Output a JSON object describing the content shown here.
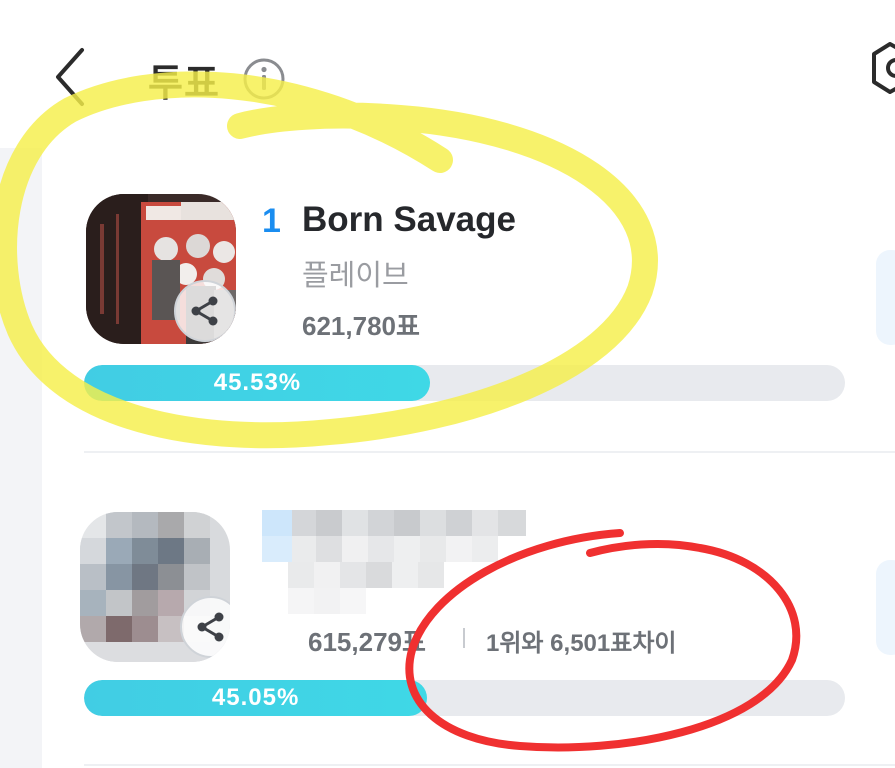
{
  "header": {
    "title": "투표",
    "back_icon": "chevron-left-icon",
    "info_icon": "info-circle-icon",
    "corner_icon": "hexagon-icon"
  },
  "entries": [
    {
      "rank": "1",
      "title": "Born Savage",
      "artist": "플레이브",
      "votes": "621,780표",
      "percent_label": "45.53%",
      "percent": 45.53
    },
    {
      "rank": "",
      "title": "",
      "artist": "",
      "votes": "615,279표",
      "gap_label": "1위와 6,501표차이",
      "percent_label": "45.05%",
      "percent": 45.05
    }
  ],
  "colors": {
    "rank_blue": "#1a8df0",
    "bar_fill": "#41cde4",
    "bar_track": "#e8eaee",
    "yellow_marker": "#f5ef4a",
    "red_marker": "#f03030"
  }
}
